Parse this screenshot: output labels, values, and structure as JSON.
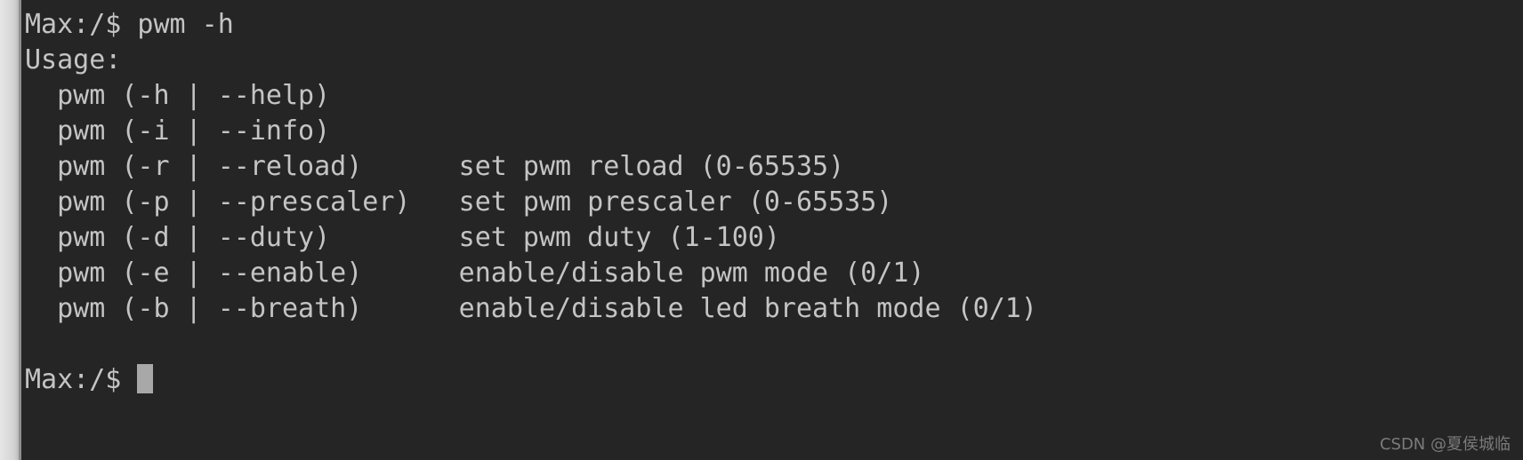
{
  "terminal": {
    "background_color": "#252525",
    "text_color": "#c4c4c4",
    "gutter_color": "#dcdcdc",
    "cursor_color": "#a8a8a8",
    "prompt": "Max:/$",
    "command_line": "Max:/$ pwm -h",
    "usage_header": "Usage:",
    "lines": [
      {
        "text": "Max:/$ pwm -h"
      },
      {
        "text": "Usage:"
      },
      {
        "text": "  pwm (-h | --help)"
      },
      {
        "text": "  pwm (-i | --info)"
      },
      {
        "text": "  pwm (-r | --reload)      set pwm reload (0-65535)"
      },
      {
        "text": "  pwm (-p | --prescaler)   set pwm prescaler (0-65535)"
      },
      {
        "text": "  pwm (-d | --duty)        set pwm duty (1-100)"
      },
      {
        "text": "  pwm (-e | --enable)      enable/disable pwm mode (0/1)"
      },
      {
        "text": "  pwm (-b | --breath)      enable/disable led breath mode (0/1)"
      },
      {
        "text": ""
      }
    ],
    "options": [
      {
        "usage": "  pwm (-h | --help)",
        "short": "-h",
        "long": "--help",
        "description": ""
      },
      {
        "usage": "  pwm (-i | --info)",
        "short": "-i",
        "long": "--info",
        "description": ""
      },
      {
        "usage": "  pwm (-r | --reload)",
        "short": "-r",
        "long": "--reload",
        "description": "set pwm reload (0-65535)"
      },
      {
        "usage": "  pwm (-p | --prescaler)",
        "short": "-p",
        "long": "--prescaler",
        "description": "set pwm prescaler (0-65535)"
      },
      {
        "usage": "  pwm (-d | --duty)",
        "short": "-d",
        "long": "--duty",
        "description": "set pwm duty (1-100)"
      },
      {
        "usage": "  pwm (-e | --enable)",
        "short": "-e",
        "long": "--enable",
        "description": "enable/disable pwm mode (0/1)"
      },
      {
        "usage": "  pwm (-b | --breath)",
        "short": "-b",
        "long": "--breath",
        "description": "enable/disable led breath mode (0/1)"
      }
    ],
    "final_prompt": "Max:/$ "
  },
  "watermark": {
    "text": "CSDN @夏侯城临"
  }
}
